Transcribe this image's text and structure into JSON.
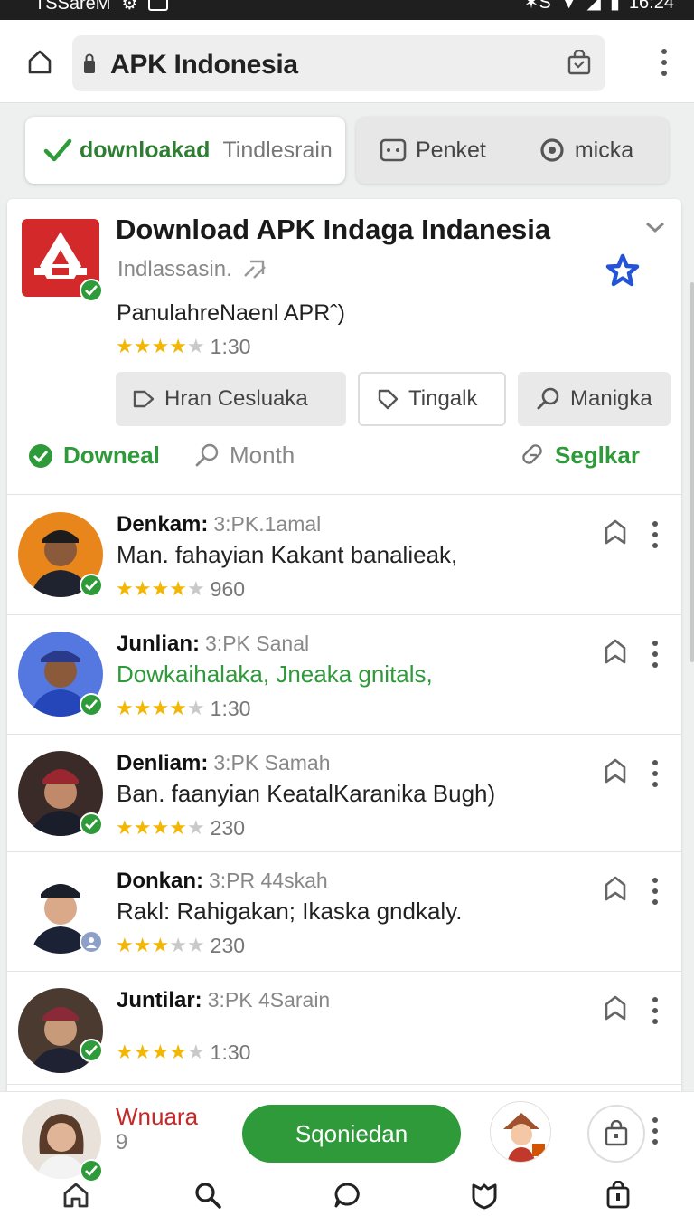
{
  "status_bar": {
    "carrier": "TSSareM",
    "time": "16:24",
    "signal_label": "✶S"
  },
  "address_bar": {
    "url": "APK Indonesia"
  },
  "tabs": [
    {
      "label": "downloakad",
      "secondary": "Tindlesrain",
      "active": true
    },
    {
      "label": "Penket",
      "secondary": "micka",
      "active": false
    }
  ],
  "app": {
    "title": "Download APK Indaga Indanesia",
    "subtitle": "Indlassasin.",
    "name": "PanulahreNaenl APRˆ)",
    "rating_value": 3.5,
    "rating_text": "1:30",
    "logo_color": "#d3292b",
    "actions": [
      {
        "label": "Hran Cesluaka",
        "icon": "bookmark-outline-icon"
      },
      {
        "label": "Tingalk",
        "icon": "tag-icon"
      },
      {
        "label": "Manigka",
        "icon": "search-icon"
      }
    ],
    "links": [
      {
        "label": "Downeal",
        "icon": "check-circle-icon"
      },
      {
        "label": "Month",
        "icon": "search-icon"
      },
      {
        "label": "Seglkar",
        "icon": "share-icon"
      }
    ]
  },
  "reviews": [
    {
      "author": "Denkam:",
      "meta": "3:PK.1amal",
      "text": "Man. fahayian Kakant banalieak,",
      "text_color": "dark",
      "rating_value": 3.5,
      "rating_text": "960"
    },
    {
      "author": "Junlian:",
      "meta": "3:PK Sanal",
      "text": "Dowkaihalaka, Jneaka gnitals,",
      "text_color": "green",
      "rating_value": 3.5,
      "rating_text": "1:30"
    },
    {
      "author": "Denliam:",
      "meta": "3:PK Samah",
      "text": "Ban. faanyian KeatalKaranika Bugh)",
      "text_color": "dark",
      "rating_value": 4,
      "rating_text": "230"
    },
    {
      "author": "Donkan:",
      "meta": "3:PR 44skah",
      "text": "Rakl: Rahigakan; Ikaska gndkaly.",
      "text_color": "dark",
      "rating_value": 3,
      "rating_text": "230"
    },
    {
      "author": "Juntilar:",
      "meta": "3:PK 4Sarain",
      "text": "",
      "text_color": "dark",
      "rating_value": 3.5,
      "rating_text": "1:30"
    }
  ],
  "bottom_bar": {
    "user_name": "Wnuara",
    "user_count": "9",
    "cta_label": "Sqoniedan"
  },
  "colors": {
    "accent_green": "#2e9a3a",
    "star": "#f2b705",
    "brand_red": "#d3292b",
    "name_red": "#c62828"
  }
}
